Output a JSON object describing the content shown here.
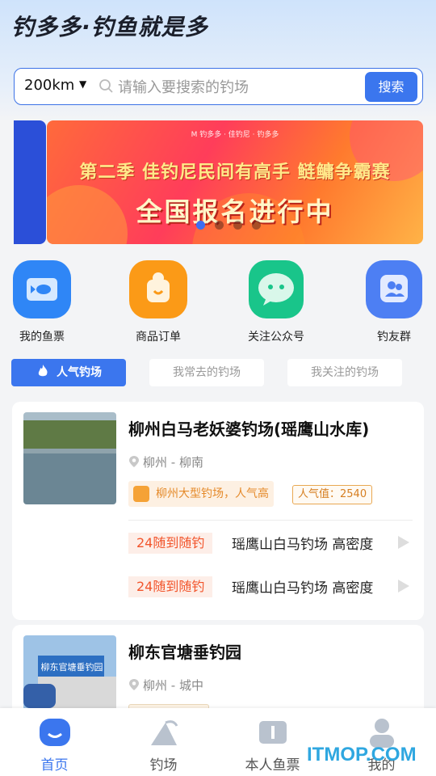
{
  "header": {
    "logo_text": "钓多多·钓鱼就是多"
  },
  "search": {
    "distance": "200km",
    "placeholder": "请输入要搜索的钓场",
    "button": "搜索"
  },
  "banner": {
    "top_text": "M 钓多多 · 佳钓尼 · 钓多多",
    "line1": "第二季 佳钓尼民间有高手 鲢鳙争霸赛",
    "line2": "全国报名进行中",
    "dots": 4,
    "active_dot": 0
  },
  "quick_links": [
    {
      "label": "我的鱼票",
      "icon": "fish-ticket-icon",
      "color": "#2f86f6"
    },
    {
      "label": "商品订单",
      "icon": "order-bag-icon",
      "color": "#fb9a17"
    },
    {
      "label": "关注公众号",
      "icon": "wechat-chat-icon",
      "color": "#19c58a"
    },
    {
      "label": "钓友群",
      "icon": "group-users-icon",
      "color": "#4d7ff3"
    }
  ],
  "tabs": [
    "人气钓场",
    "我常去的钓场",
    "我关注的钓场"
  ],
  "spots": [
    {
      "name": "柳州白马老妖婆钓场(瑶鹰山水库)",
      "location": "柳州 - 柳南",
      "feature_tag": "柳州大型钓场，人气高",
      "popularity": "人气值：2540",
      "deals": [
        {
          "tag": "24随到随钓",
          "text": "瑶鹰山白马钓场 高密度"
        },
        {
          "tag": "24随到随钓",
          "text": "瑶鹰山白马钓场 高密度"
        }
      ]
    },
    {
      "name": "柳东官塘垂钓园",
      "location": "柳州 - 城中",
      "sign_text": "柳东官塘垂钓园"
    }
  ],
  "bottom_nav": [
    {
      "label": "首页",
      "icon": "home-icon",
      "active": true
    },
    {
      "label": "钓场",
      "icon": "fishing-spot-icon",
      "active": false
    },
    {
      "label": "本人鱼票",
      "icon": "ticket-icon",
      "active": false
    },
    {
      "label": "我的",
      "icon": "profile-icon",
      "active": false
    }
  ],
  "watermark": "ITMOP.COM",
  "colors": {
    "accent": "#3b76ee",
    "deal": "#f2552c",
    "tag": "#e58a2a"
  }
}
